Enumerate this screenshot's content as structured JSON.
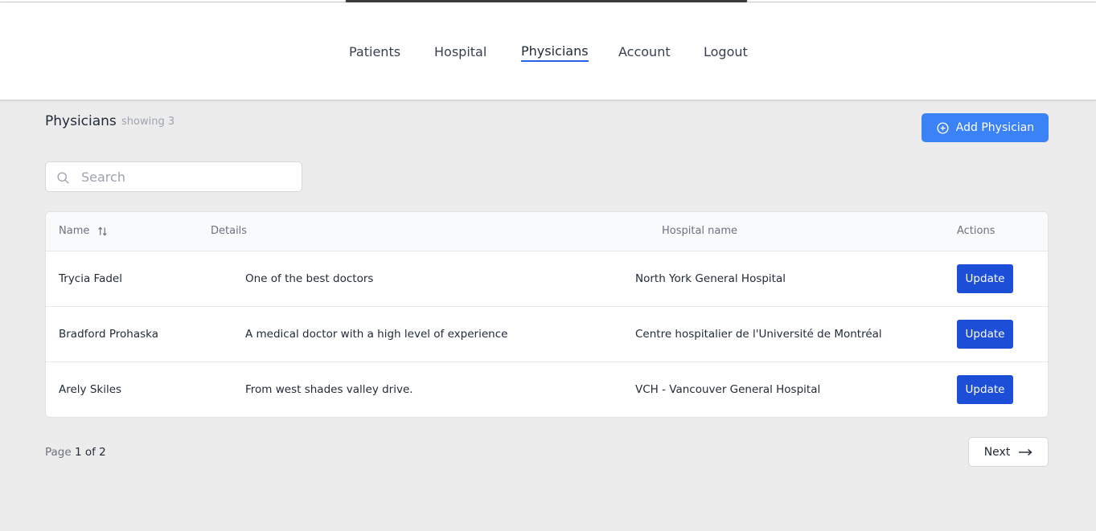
{
  "nav": {
    "items": [
      {
        "label": "Patients"
      },
      {
        "label": "Hospital"
      },
      {
        "label": "Physicians",
        "active": true
      },
      {
        "label": "Account"
      },
      {
        "label": "Logout"
      }
    ]
  },
  "page": {
    "title": "Physicians",
    "count_label": "showing 3",
    "add_button_label": "Add Physician"
  },
  "search": {
    "placeholder": "Search",
    "value": ""
  },
  "table": {
    "headers": {
      "name": "Name",
      "details": "Details",
      "hospital": "Hospital name",
      "actions": "Actions"
    },
    "rows": [
      {
        "name": "Trycia Fadel",
        "details": "One of the best doctors",
        "hospital": "North York General Hospital",
        "action": "Update"
      },
      {
        "name": "Bradford Prohaska",
        "details": "A medical doctor with a high level of experience",
        "hospital": "Centre hospitalier de l'Université de Montréal",
        "action": "Update"
      },
      {
        "name": "Arely Skiles",
        "details": "From west shades valley drive.",
        "hospital": "VCH - Vancouver General Hospital",
        "action": "Update"
      }
    ]
  },
  "pagination": {
    "prefix": "Page",
    "current": "1 of 2",
    "next_label": "Next"
  },
  "colors": {
    "primary": "#3b82f6",
    "update": "#1d4ed8",
    "nav_underline": "#2563eb"
  }
}
